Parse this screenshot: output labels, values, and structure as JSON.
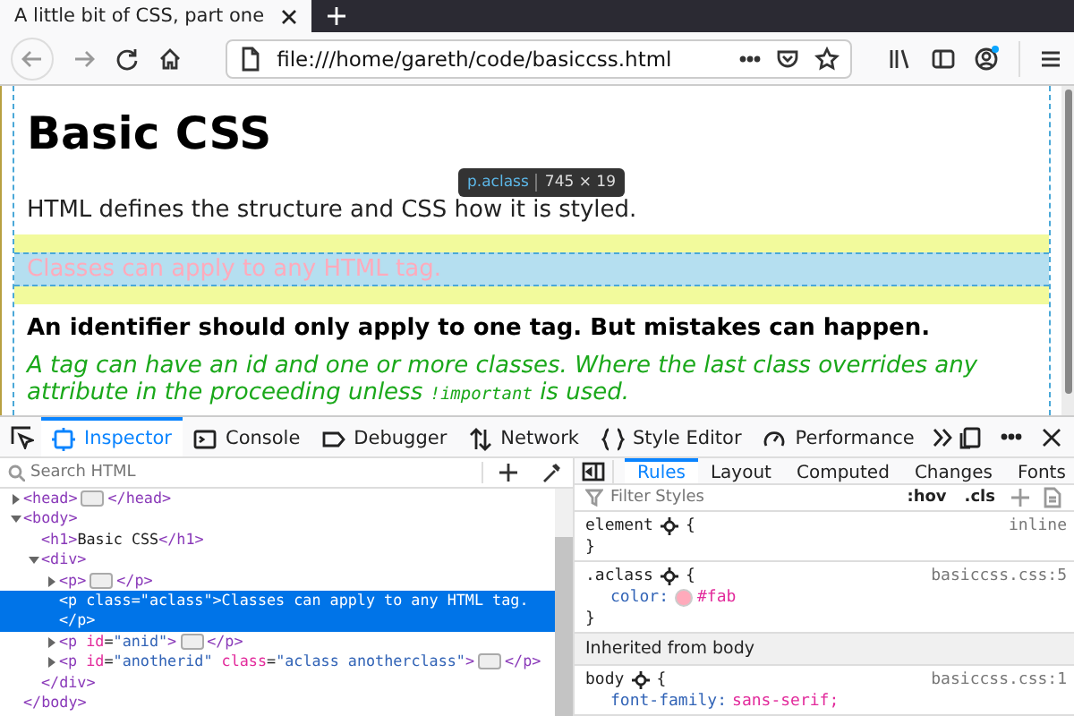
{
  "browser_tab": {
    "title": "A little bit of CSS, part one"
  },
  "address_bar": {
    "url": "file:///home/gareth/code/basiccss.html"
  },
  "page": {
    "heading": "Basic CSS",
    "paragraphs": [
      {
        "kind": "plain",
        "highlighted": false,
        "parts": [
          {
            "text": "HTML defines the structure and CSS how it is styled.",
            "code": false
          }
        ]
      },
      {
        "kind": "pink",
        "highlighted": true,
        "parts": [
          {
            "text": "Classes can apply to any HTML tag.",
            "code": false
          }
        ]
      },
      {
        "kind": "bold",
        "highlighted": false,
        "parts": [
          {
            "text": "An identifier should only apply to one tag. But mistakes can happen.",
            "code": false
          }
        ]
      },
      {
        "kind": "green",
        "highlighted": false,
        "parts": [
          {
            "text": "A tag can have an id and one or more classes. Where the last class overrides any attribute in the proceeding unless ",
            "code": false
          },
          {
            "text": "!important",
            "code": true
          },
          {
            "text": " is used.",
            "code": false
          }
        ]
      }
    ],
    "tooltip": {
      "selector": "p.aclass",
      "size": "745 × 19"
    }
  },
  "devtools": {
    "tabs": [
      {
        "label": "Inspector",
        "selected": true
      },
      {
        "label": "Console",
        "selected": false
      },
      {
        "label": "Debugger",
        "selected": false
      },
      {
        "label": "Network",
        "selected": false
      },
      {
        "label": "Style Editor",
        "selected": false
      },
      {
        "label": "Performance",
        "selected": false
      }
    ],
    "search": {
      "placeholder": "Search HTML"
    },
    "tree": [
      {
        "open": "<head>",
        "close": "</head>",
        "collapsed": true,
        "expanded": false,
        "selected": false
      },
      {
        "open": "<body>",
        "close": "</body>",
        "collapsed": false,
        "expanded": true,
        "selected": false,
        "children": [
          {
            "open": "<h1>Basic CSS</h1>",
            "collapsed": false,
            "expanded": false,
            "selected": false
          },
          {
            "open": "<div>",
            "close": "</div>",
            "collapsed": false,
            "expanded": true,
            "selected": false,
            "children": [
              {
                "open": "<p>",
                "close": "</p>",
                "collapsed": true,
                "expanded": false,
                "selected": false
              },
              {
                "open": "<p class=\"aclass\">Classes can apply to any HTML tag.",
                "close": "</p>",
                "collapsed": false,
                "expanded": false,
                "selected": true
              },
              {
                "open": "<p id=\"anid\">",
                "close": "</p>",
                "collapsed": true,
                "expanded": false,
                "selected": false
              },
              {
                "open": "<p id=\"anotherid\" class=\"aclass anotherclass\">",
                "close": "</p>",
                "collapsed": true,
                "expanded": false,
                "selected": false
              }
            ]
          }
        ]
      }
    ],
    "sidebar_tabs": [
      {
        "label": "Rules",
        "selected": true
      },
      {
        "label": "Layout",
        "selected": false
      },
      {
        "label": "Computed",
        "selected": false
      },
      {
        "label": "Changes",
        "selected": false
      },
      {
        "label": "Fonts",
        "selected": false
      }
    ],
    "filter": {
      "placeholder": "Filter Styles"
    },
    "toggles": [
      ":hov",
      ".cls"
    ],
    "rules": [
      {
        "kind": "rule",
        "selector": "element",
        "open_brace": "{",
        "source": "inline",
        "close_brace": "}"
      },
      {
        "kind": "rule",
        "selector": ".aclass",
        "open_brace": "{",
        "source": "basiccss.css:5",
        "declarations": [
          {
            "property": "color:",
            "value": "#fab",
            "swatch": true
          }
        ],
        "close_brace": "}"
      },
      {
        "kind": "header",
        "text": "Inherited from body"
      },
      {
        "kind": "rule",
        "selector": "body",
        "open_brace": "{",
        "source": "basiccss.css:1",
        "declarations": [
          {
            "property": "font-family:",
            "value": "sans-serif;",
            "swatch": false
          }
        ]
      }
    ]
  }
}
